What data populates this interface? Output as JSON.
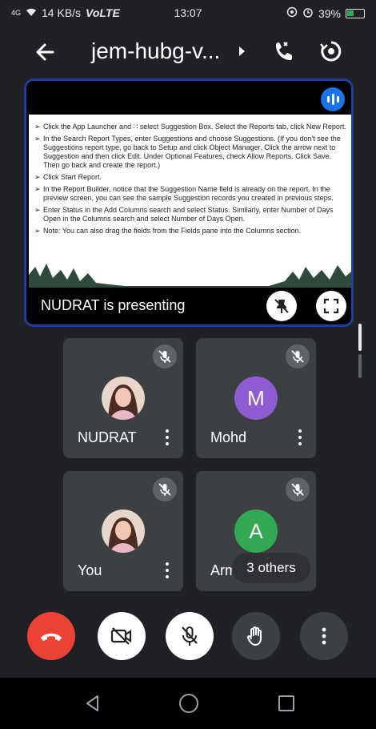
{
  "status_bar": {
    "signal": "4G",
    "speed": "14 KB/s",
    "network": "VoLTE",
    "time": "13:07",
    "battery": "39%"
  },
  "header": {
    "title": "jem-hubg-v...",
    "icons": [
      "back-arrow-icon",
      "chevron-right-icon",
      "phone-icon",
      "switch-camera-icon"
    ]
  },
  "presentation": {
    "slide_bullets": [
      "Click the App Launcher and ∷ select Suggestion Box. Select the Reports tab, click New Report.",
      "In the Search Report Types, enter Suggestions and choose Suggestions. (If you don't see the Suggestions report type, go back to Setup and click Object Manager. Click the arrow next to Suggestion and then click Edit. Under Optional Features, check Allow Reports. Click Save. Then go back and create the report.)",
      "Click Start Report.",
      "In the Report Builder, notice that the Suggestion Name field is already on the report. In the preview screen, you can see the sample Suggestion records you created in previous steps.",
      "Enter Status in the Add Columns search and select Status. Similarly, enter Number of Days Open in the Columns search and select Number of Days Open.",
      "Note: You can also drag the fields from the Fields pane into the Columns section."
    ],
    "label": "NUDRAT is presenting"
  },
  "participants": [
    {
      "name": "NUDRAT",
      "avatar_type": "photo",
      "muted": true
    },
    {
      "name": "Mohd",
      "avatar_type": "initial",
      "initial": "M",
      "color": "#8e5bd1",
      "muted": true
    },
    {
      "name": "You",
      "avatar_type": "photo",
      "muted": true
    },
    {
      "name": "Arma",
      "avatar_type": "initial",
      "initial": "A",
      "color": "#34a853",
      "muted": true
    }
  ],
  "others_chip": "3 others",
  "colors": {
    "background": "#202124",
    "tile": "#3c4043",
    "end_call": "#ea4335",
    "presenter_border": "#1e3fa0",
    "speaking": "#1a73e8"
  }
}
